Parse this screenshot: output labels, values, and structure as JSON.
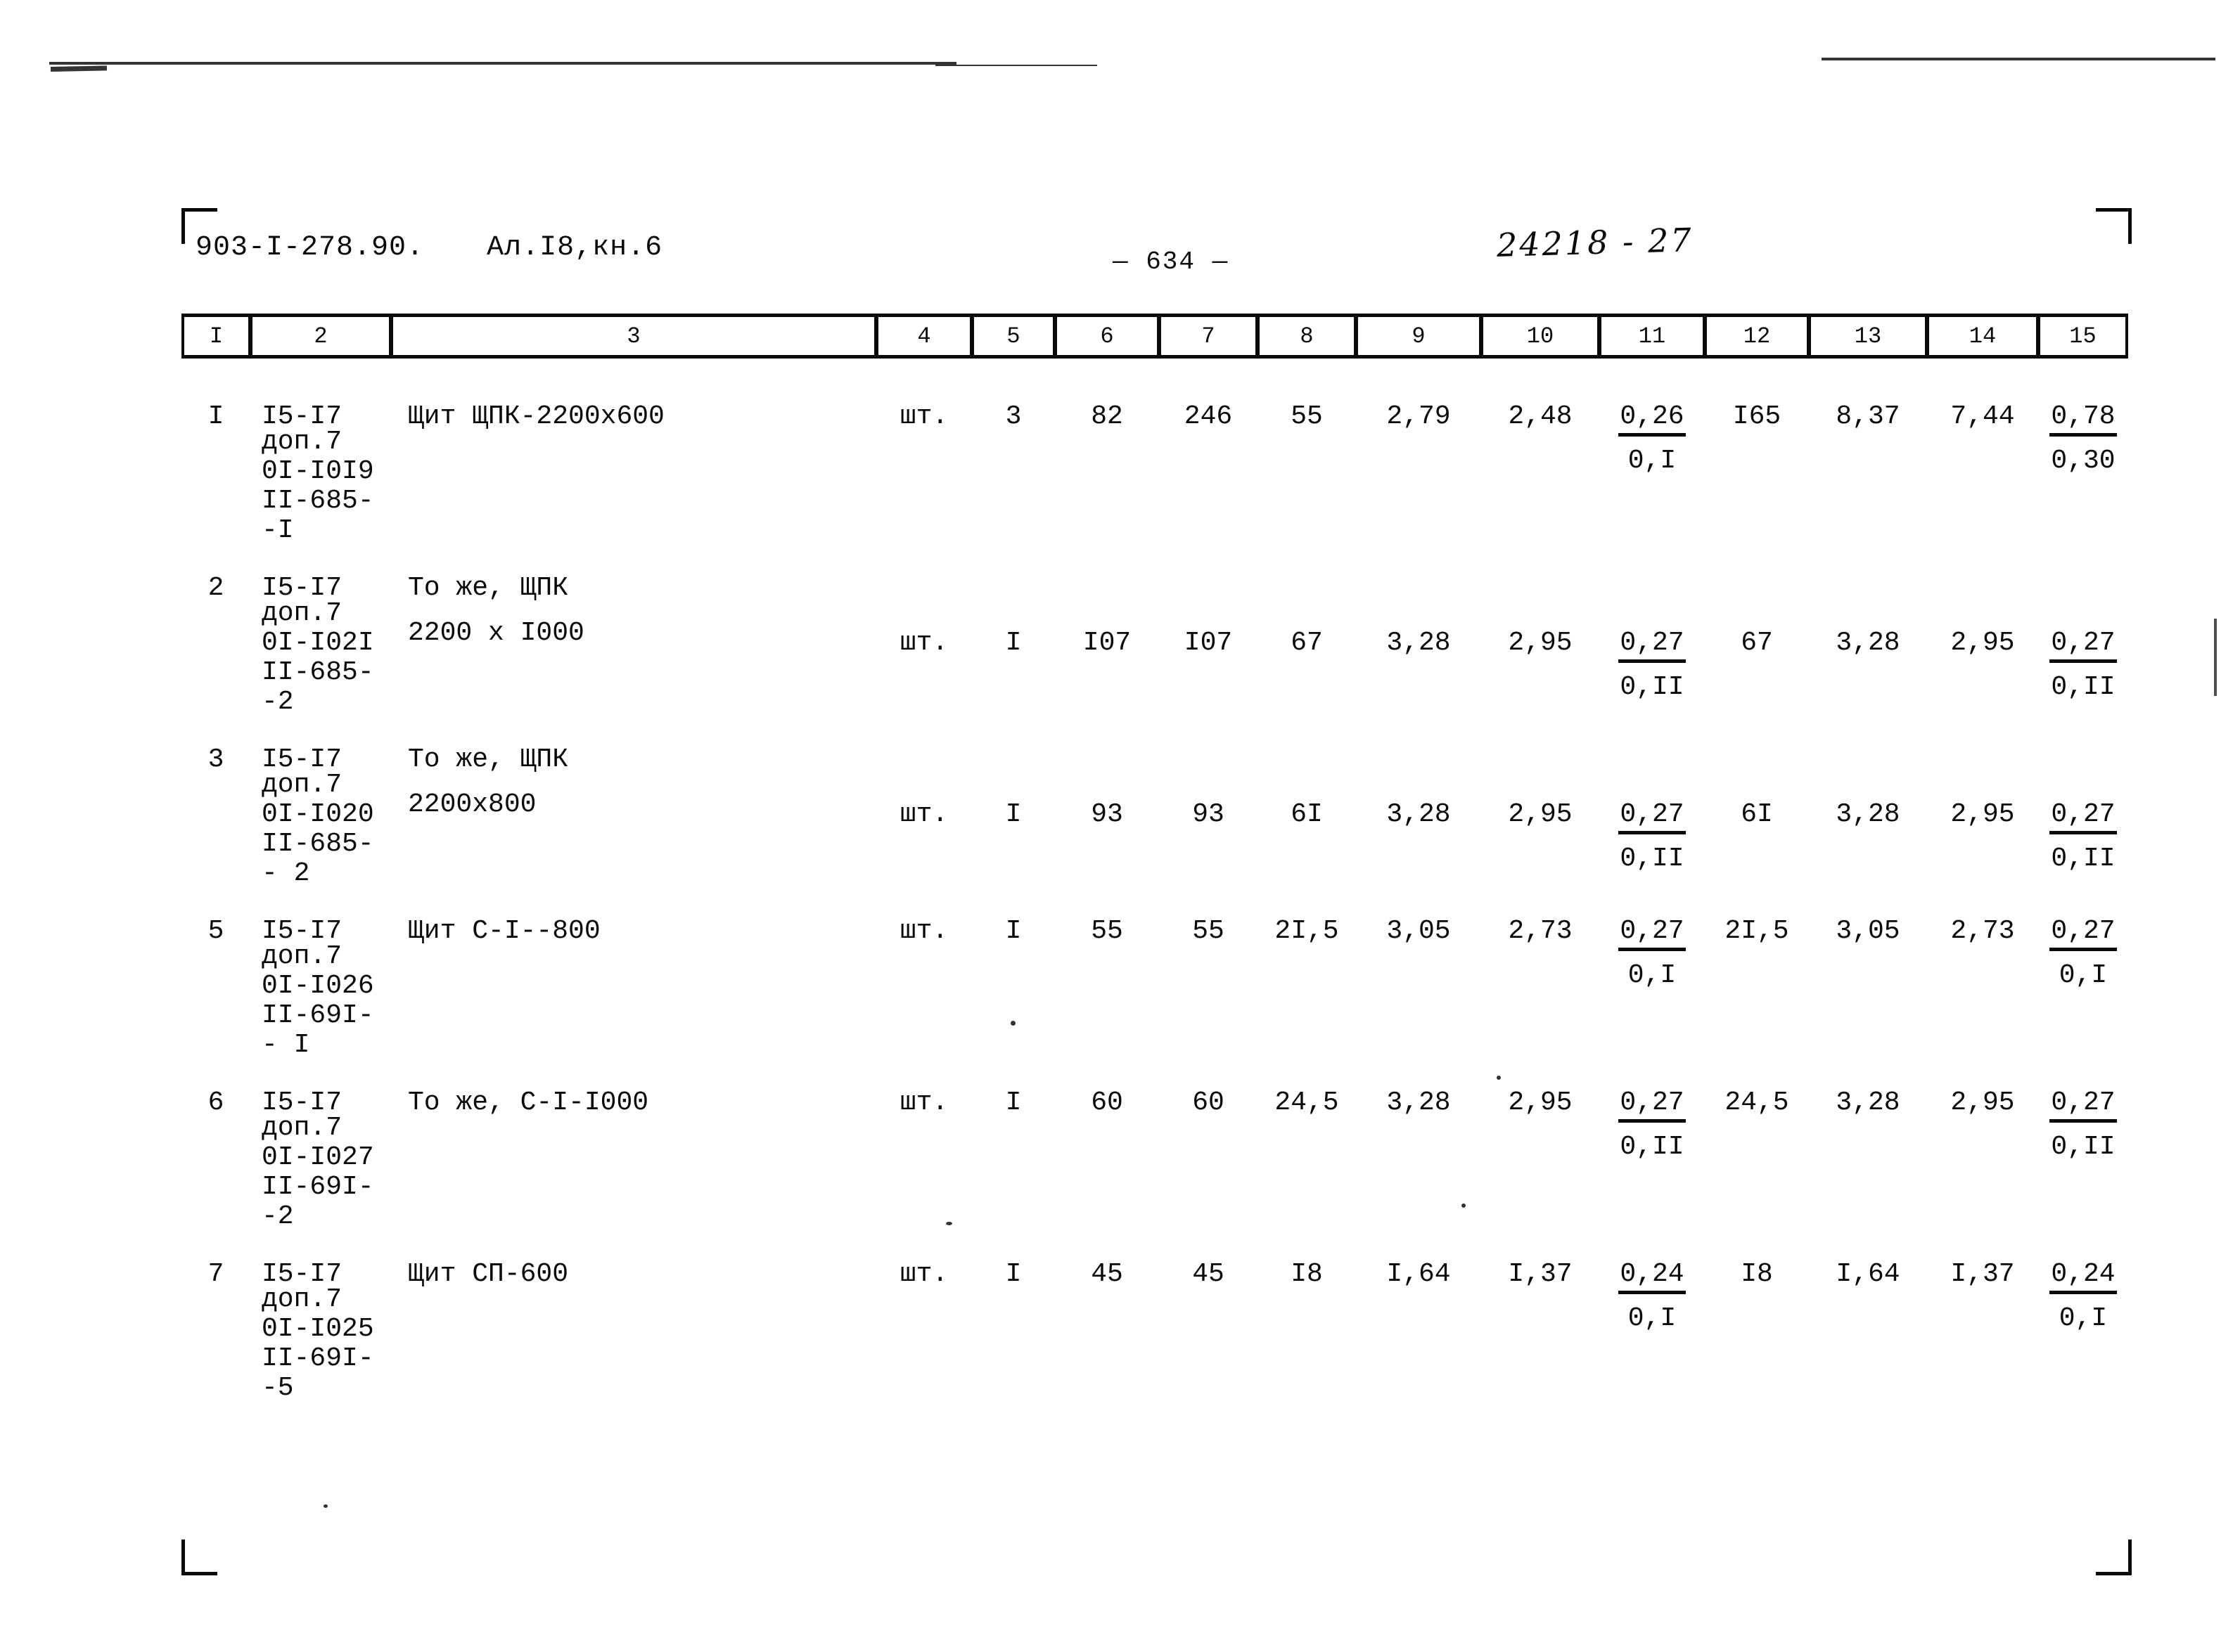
{
  "header": {
    "doc_code": "903-I-278.90.",
    "album": "Ал.I8,кн.6",
    "page_number": "— 634 —",
    "archive_stamp": "24218 - 27"
  },
  "table": {
    "column_headers": [
      "I",
      "2",
      "3",
      "4",
      "5",
      "6",
      "7",
      "8",
      "9",
      "10",
      "11",
      "12",
      "13",
      "14",
      "15"
    ],
    "rows": [
      {
        "num": "I",
        "code_lines": [
          "I5-I7",
          "доп.7",
          "0I-I0I9",
          "II-685-",
          "-I"
        ],
        "name_lines": [
          "Щит ЩПК-2200х600"
        ],
        "unit": "шт.",
        "c5": "3",
        "c6": "82",
        "c7": "246",
        "c8": "55",
        "c9": "2,79",
        "c10": "2,48",
        "c11_top": "0,26",
        "c11_bot": "0,I",
        "c12": "I65",
        "c13": "8,37",
        "c14": "7,44",
        "c15_top": "0,78",
        "c15_bot": "0,30"
      },
      {
        "num": "2",
        "code_lines": [
          "I5-I7",
          "доп.7",
          "0I-I02I",
          "II-685-",
          "-2"
        ],
        "name_lines": [
          "То же, ЩПК",
          "2200 х I000"
        ],
        "unit": "шт.",
        "c5": "I",
        "c6": "I07",
        "c7": "I07",
        "c8": "67",
        "c9": "3,28",
        "c10": "2,95",
        "c11_top": "0,27",
        "c11_bot": "0,II",
        "c12": "67",
        "c13": "3,28",
        "c14": "2,95",
        "c15_top": "0,27",
        "c15_bot": "0,II"
      },
      {
        "num": "3",
        "code_lines": [
          "I5-I7",
          "доп.7",
          "0I-I020",
          "II-685-",
          "- 2"
        ],
        "name_lines": [
          "То же, ЩПК",
          "2200х800"
        ],
        "unit": "шт.",
        "c5": "I",
        "c6": "93",
        "c7": "93",
        "c8": "6I",
        "c9": "3,28",
        "c10": "2,95",
        "c11_top": "0,27",
        "c11_bot": "0,II",
        "c12": "6I",
        "c13": "3,28",
        "c14": "2,95",
        "c15_top": "0,27",
        "c15_bot": "0,II"
      },
      {
        "num": "5",
        "code_lines": [
          "I5-I7",
          "доп.7",
          "0I-I026",
          "II-69I-",
          "- I"
        ],
        "name_lines": [
          "Щит С-I--800"
        ],
        "unit": "шт.",
        "c5": "I",
        "c6": "55",
        "c7": "55",
        "c8": "2I,5",
        "c9": "3,05",
        "c10": "2,73",
        "c11_top": "0,27",
        "c11_bot": "0,I",
        "c12": "2I,5",
        "c13": "3,05",
        "c14": "2,73",
        "c15_top": "0,27",
        "c15_bot": "0,I"
      },
      {
        "num": "6",
        "code_lines": [
          "I5-I7",
          "доп.7",
          "0I-I027",
          "II-69I-",
          "-2"
        ],
        "name_lines": [
          "То же, С-I-I000"
        ],
        "unit": "шт.",
        "c5": "I",
        "c6": "60",
        "c7": "60",
        "c8": "24,5",
        "c9": "3,28",
        "c10": "2,95",
        "c11_top": "0,27",
        "c11_bot": "0,II",
        "c12": "24,5",
        "c13": "3,28",
        "c14": "2,95",
        "c15_top": "0,27",
        "c15_bot": "0,II"
      },
      {
        "num": "7",
        "code_lines": [
          "I5-I7",
          "доп.7",
          "0I-I025",
          "II-69I-",
          "-5"
        ],
        "name_lines": [
          "Щит СП-600"
        ],
        "unit": "шт.",
        "c5": "I",
        "c6": "45",
        "c7": "45",
        "c8": "I8",
        "c9": "I,64",
        "c10": "I,37",
        "c11_top": "0,24",
        "c11_bot": "0,I",
        "c12": "I8",
        "c13": "I,64",
        "c14": "I,37",
        "c15_top": "0,24",
        "c15_bot": "0,I"
      }
    ]
  }
}
